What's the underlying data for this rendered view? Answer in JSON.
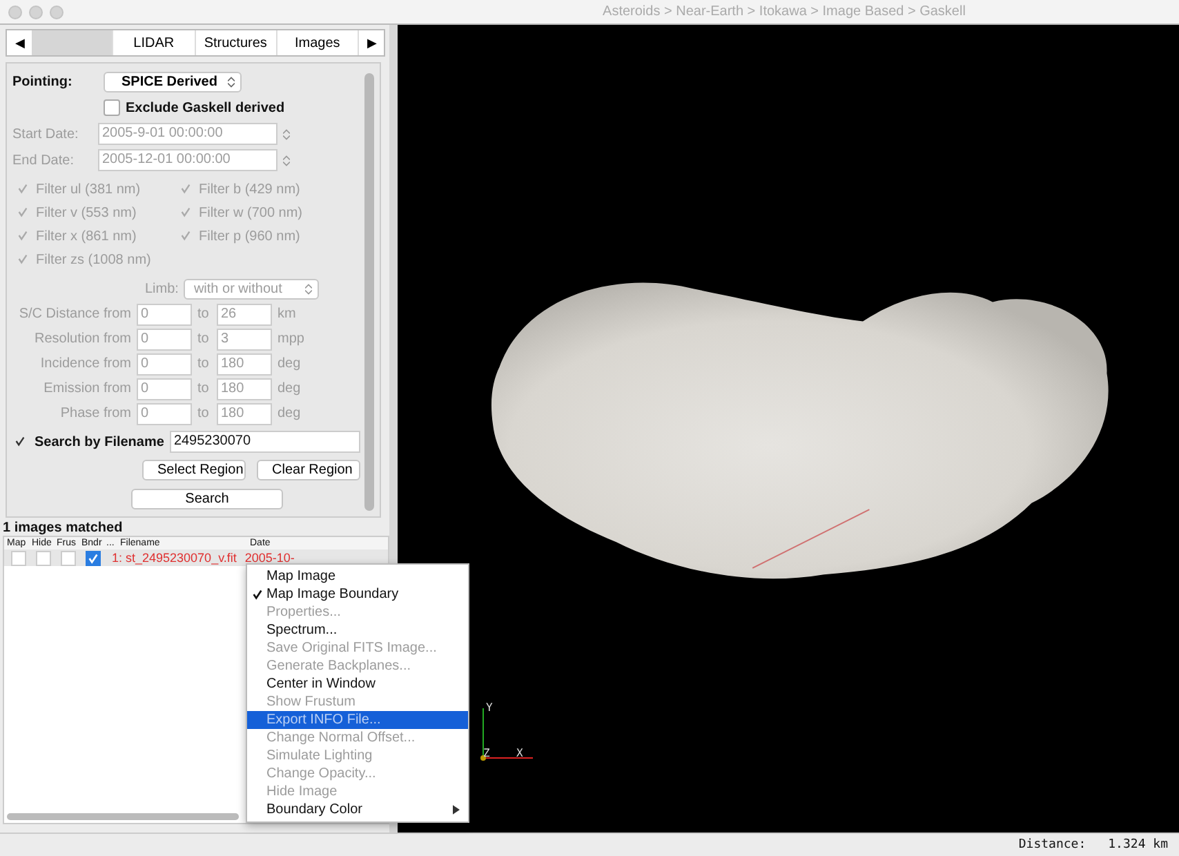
{
  "window": {
    "title": "Asteroids > Near-Earth > Itokawa > Image Based > Gaskell"
  },
  "tabs": [
    {
      "selected": true
    },
    {
      "label": "LIDAR",
      "selected": false
    },
    {
      "label": "Structures",
      "selected": false
    },
    {
      "label": "Images",
      "selected": false
    }
  ],
  "tab_arrows": {
    "left": "◀",
    "right": "▶"
  },
  "pointing": {
    "label": "Pointing:",
    "value": "SPICE Derived"
  },
  "exclude_gaskell": {
    "label": "Exclude Gaskell derived",
    "checked": false
  },
  "dates": [
    {
      "label": "Start Date:",
      "value": "2005-9-01 00:00:00",
      "disabled": true
    },
    {
      "label": "End Date:",
      "value": "2005-12-01 00:00:00",
      "disabled": true
    }
  ],
  "filters": [
    {
      "label": "Filter ul (381 nm)",
      "checked": true,
      "disabled": true
    },
    {
      "label": "Filter b (429 nm)",
      "checked": true,
      "disabled": true
    },
    {
      "label": "Filter v (553 nm)",
      "checked": true,
      "disabled": true
    },
    {
      "label": "Filter w (700 nm)",
      "checked": true,
      "disabled": true
    },
    {
      "label": "Filter x (861 nm)",
      "checked": true,
      "disabled": true
    },
    {
      "label": "Filter p (960 nm)",
      "checked": true,
      "disabled": true
    },
    {
      "label": "Filter zs (1008 nm)",
      "checked": true,
      "disabled": true
    }
  ],
  "limb": {
    "label": "Limb:",
    "value": "with or without",
    "disabled": true
  },
  "ranges": [
    {
      "label": "S/C Distance from",
      "from": "0",
      "to_label": "to",
      "to": "26",
      "unit": "km"
    },
    {
      "label": "Resolution from",
      "from": "0",
      "to_label": "to",
      "to": "3",
      "unit": "mpp"
    },
    {
      "label": "Incidence from",
      "from": "0",
      "to_label": "to",
      "to": "180",
      "unit": "deg"
    },
    {
      "label": "Emission from",
      "from": "0",
      "to_label": "to",
      "to": "180",
      "unit": "deg"
    },
    {
      "label": "Phase from",
      "from": "0",
      "to_label": "to",
      "to": "180",
      "unit": "deg"
    }
  ],
  "search_by_filename": {
    "label": "Search by Filename",
    "checked": true,
    "value": "2495230070"
  },
  "buttons": {
    "select_region": "Select Region",
    "clear_region": "Clear Region",
    "search": "Search"
  },
  "results": {
    "summary": "1 images matched",
    "columns": [
      "Map",
      "Hide",
      "Frus",
      "Bndr",
      "...",
      "Filename",
      "Date"
    ],
    "rows": [
      {
        "map": false,
        "hide": false,
        "frus": false,
        "bndr": true,
        "filename": "1: st_2495230070_v.fit",
        "date": "2005-10-"
      }
    ]
  },
  "context_menu": [
    {
      "label": "Map Image",
      "checked": false,
      "disabled": false,
      "selected": false,
      "submenu": false
    },
    {
      "label": "Map Image Boundary",
      "checked": true,
      "disabled": false,
      "selected": false,
      "submenu": false
    },
    {
      "label": "Properties...",
      "checked": false,
      "disabled": true,
      "selected": false,
      "submenu": false
    },
    {
      "label": "Spectrum...",
      "checked": false,
      "disabled": false,
      "selected": false,
      "submenu": false
    },
    {
      "label": "Save Original FITS Image...",
      "checked": false,
      "disabled": true,
      "selected": false,
      "submenu": false
    },
    {
      "label": "Generate Backplanes...",
      "checked": false,
      "disabled": true,
      "selected": false,
      "submenu": false
    },
    {
      "label": "Center in Window",
      "checked": false,
      "disabled": false,
      "selected": false,
      "submenu": false
    },
    {
      "label": "Show Frustum",
      "checked": false,
      "disabled": true,
      "selected": false,
      "submenu": false
    },
    {
      "label": "Export INFO File...",
      "checked": false,
      "disabled": true,
      "selected": true,
      "submenu": false
    },
    {
      "label": "Change Normal Offset...",
      "checked": false,
      "disabled": true,
      "selected": false,
      "submenu": false
    },
    {
      "label": "Simulate Lighting",
      "checked": false,
      "disabled": true,
      "selected": false,
      "submenu": false
    },
    {
      "label": "Change Opacity...",
      "checked": false,
      "disabled": true,
      "selected": false,
      "submenu": false
    },
    {
      "label": "Hide Image",
      "checked": false,
      "disabled": true,
      "selected": false,
      "submenu": false
    },
    {
      "label": "Boundary Color",
      "checked": false,
      "disabled": false,
      "selected": false,
      "submenu": true
    }
  ],
  "viewer": {
    "axes": {
      "y": "Y",
      "z": "Z",
      "x": "X"
    }
  },
  "status_bar": {
    "label": "Distance:",
    "value": "1.324 km"
  }
}
